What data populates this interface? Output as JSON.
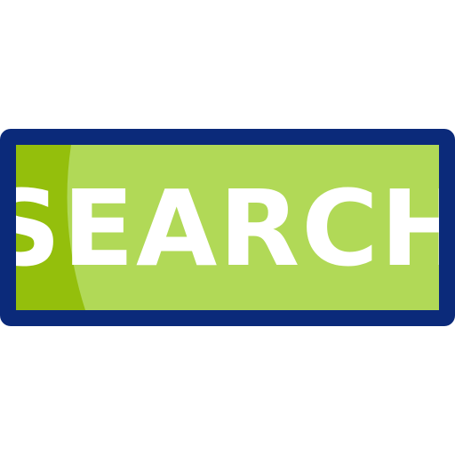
{
  "button": {
    "label": "SEARCH"
  },
  "colors": {
    "border": "#0b2a7a",
    "fill_light": "#b1d957",
    "fill_dark": "#94bf0c",
    "text": "#ffffff"
  }
}
